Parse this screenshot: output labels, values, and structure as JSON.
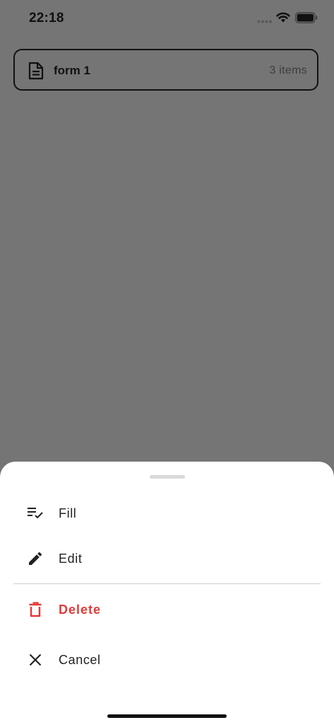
{
  "status_bar": {
    "time": "22:18"
  },
  "form_card": {
    "name": "form 1",
    "count": "3 items",
    "icon": "document-icon"
  },
  "sheet": {
    "items": [
      {
        "label": "Fill",
        "icon": "playlist-check-icon"
      },
      {
        "label": "Edit",
        "icon": "pencil-icon"
      },
      {
        "label": "Delete",
        "icon": "trash-icon",
        "color": "#e53935"
      },
      {
        "label": "Cancel",
        "icon": "close-icon"
      }
    ]
  },
  "colors": {
    "overlay_background": "#757575",
    "danger": "#e53935",
    "sheet_background": "#ffffff"
  }
}
